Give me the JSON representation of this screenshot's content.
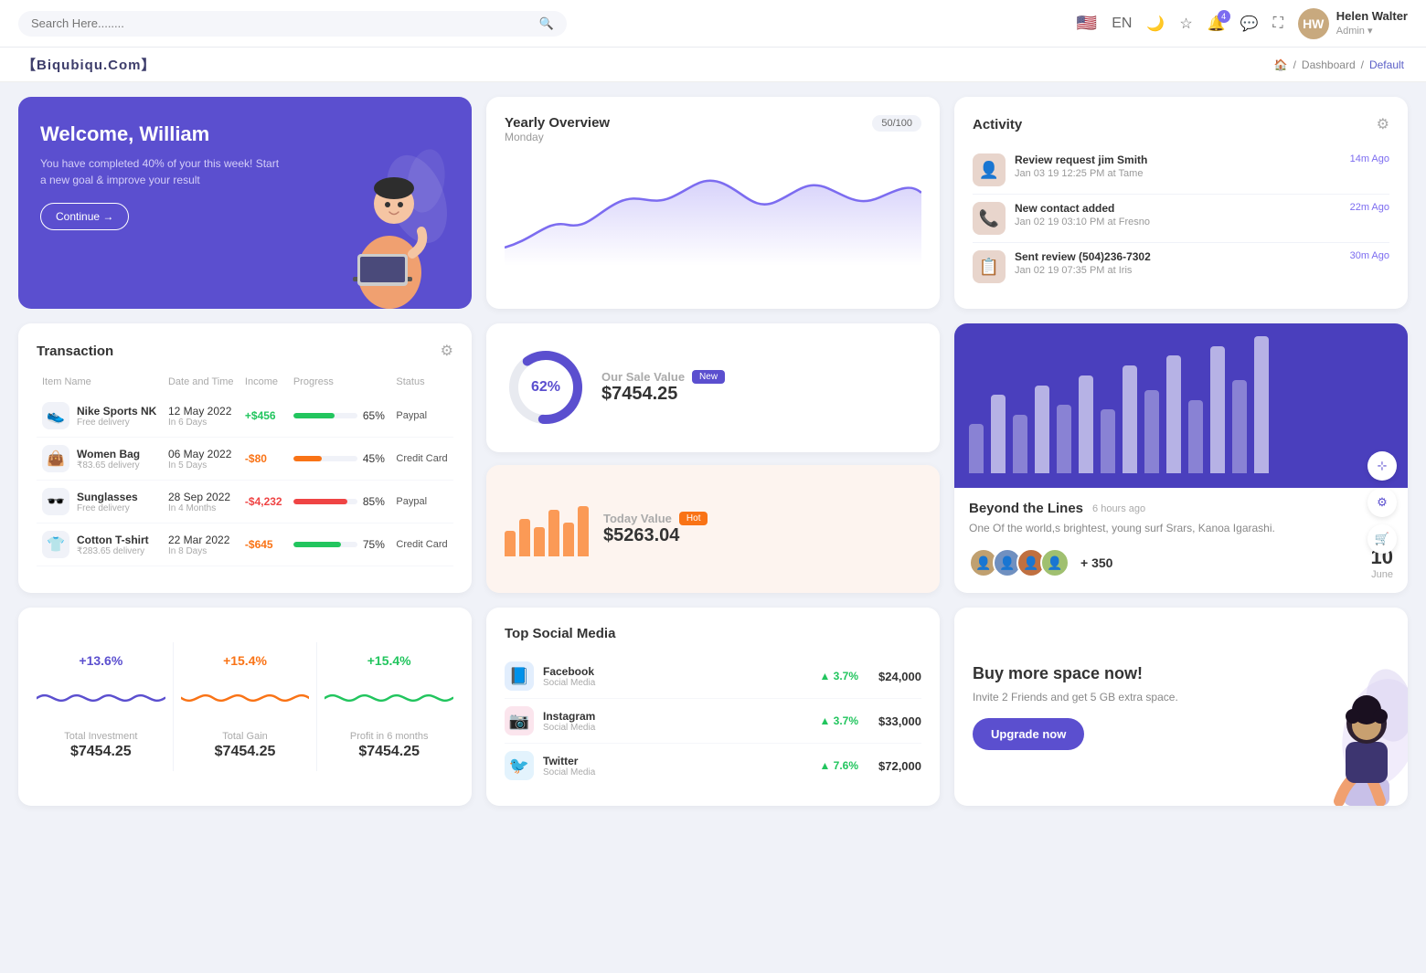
{
  "topnav": {
    "search_placeholder": "Search Here........",
    "lang": "EN",
    "user": {
      "name": "Helen Walter",
      "role": "Admin",
      "avatar_initials": "HW"
    },
    "notification_count": "4"
  },
  "breadcrumb": {
    "brand": "【Biqubiqu.Com】",
    "home": "🏠",
    "separator": "/",
    "dashboard": "Dashboard",
    "default": "Default"
  },
  "welcome": {
    "title": "Welcome, William",
    "subtitle": "You have completed 40% of your this week! Start a new goal & improve your result",
    "button": "Continue →"
  },
  "yearly_overview": {
    "title": "Yearly Overview",
    "subtitle": "Monday",
    "badge": "50/100"
  },
  "activity": {
    "title": "Activity",
    "items": [
      {
        "name": "Review request jim Smith",
        "desc": "Jan 03 19 12:25 PM at Tame",
        "time": "14m Ago",
        "emoji": "👤"
      },
      {
        "name": "New contact added",
        "desc": "Jan 02 19 03:10 PM at Fresno",
        "time": "22m Ago",
        "emoji": "📞"
      },
      {
        "name": "Sent review (504)236-7302",
        "desc": "Jan 02 19 07:35 PM at Iris",
        "time": "30m Ago",
        "emoji": "📋"
      }
    ]
  },
  "transaction": {
    "title": "Transaction",
    "columns": [
      "Item Name",
      "Date and Time",
      "Income",
      "Progress",
      "Status"
    ],
    "rows": [
      {
        "name": "Nike Sports NK",
        "sub": "Free delivery",
        "date": "12 May 2022",
        "date_sub": "In 6 Days",
        "income": "+$456",
        "income_type": "pos",
        "progress": 65,
        "progress_color": "#22c55e",
        "status": "Paypal",
        "emoji": "👟"
      },
      {
        "name": "Women Bag",
        "sub": "₹83.65 delivery",
        "date": "06 May 2022",
        "date_sub": "In 5 Days",
        "income": "-$80",
        "income_type": "neg",
        "progress": 45,
        "progress_color": "#f97316",
        "status": "Credit Card",
        "emoji": "👜"
      },
      {
        "name": "Sunglasses",
        "sub": "Free delivery",
        "date": "28 Sep 2022",
        "date_sub": "In 4 Months",
        "income": "-$4,232",
        "income_type": "red",
        "progress": 85,
        "progress_color": "#ef4444",
        "status": "Paypal",
        "emoji": "🕶️"
      },
      {
        "name": "Cotton T-shirt",
        "sub": "₹283.65 delivery",
        "date": "22 Mar 2022",
        "date_sub": "In 8 Days",
        "income": "-$645",
        "income_type": "neg",
        "progress": 75,
        "progress_color": "#22c55e",
        "status": "Credit Card",
        "emoji": "👕"
      }
    ]
  },
  "sale_value": {
    "donut_pct": "62%",
    "label": "Our Sale Value",
    "amount": "$7454.25",
    "badge": "New"
  },
  "today_value": {
    "label": "Today Value",
    "amount": "$5263.04",
    "badge": "Hot",
    "bars": [
      30,
      45,
      35,
      55,
      40,
      60
    ]
  },
  "beyond": {
    "title": "Beyond the Lines",
    "time": "6 hours ago",
    "desc": "One Of the world,s brightest, young surf Srars, Kanoa Igarashi.",
    "plus_count": "+ 350",
    "date_num": "10",
    "date_month": "June",
    "bars": [
      50,
      80,
      60,
      90,
      70,
      100,
      65,
      110,
      85,
      120,
      75,
      130,
      95,
      140
    ]
  },
  "stats": [
    {
      "pct": "+13.6%",
      "label": "Total Investment",
      "amount": "$7454.25",
      "color": "#5b4fcf"
    },
    {
      "pct": "+15.4%",
      "label": "Total Gain",
      "amount": "$7454.25",
      "color": "#f97316"
    },
    {
      "pct": "+15.4%",
      "label": "Profit in 6 months",
      "amount": "$7454.25",
      "color": "#22c55e"
    }
  ],
  "social": {
    "title": "Top Social Media",
    "items": [
      {
        "name": "Facebook",
        "type": "Social Media",
        "pct": "3.7%",
        "value": "$24,000",
        "color": "#1877f2",
        "emoji": "📘"
      },
      {
        "name": "Instagram",
        "type": "Social Media",
        "pct": "3.7%",
        "value": "$33,000",
        "color": "#e1306c",
        "emoji": "📷"
      },
      {
        "name": "Twitter",
        "type": "Social Media",
        "pct": "7.6%",
        "value": "$72,000",
        "color": "#1da1f2",
        "emoji": "🐦"
      }
    ]
  },
  "upgrade": {
    "title": "Buy more space now!",
    "desc": "Invite 2 Friends and get 5 GB extra space.",
    "button": "Upgrade now"
  }
}
